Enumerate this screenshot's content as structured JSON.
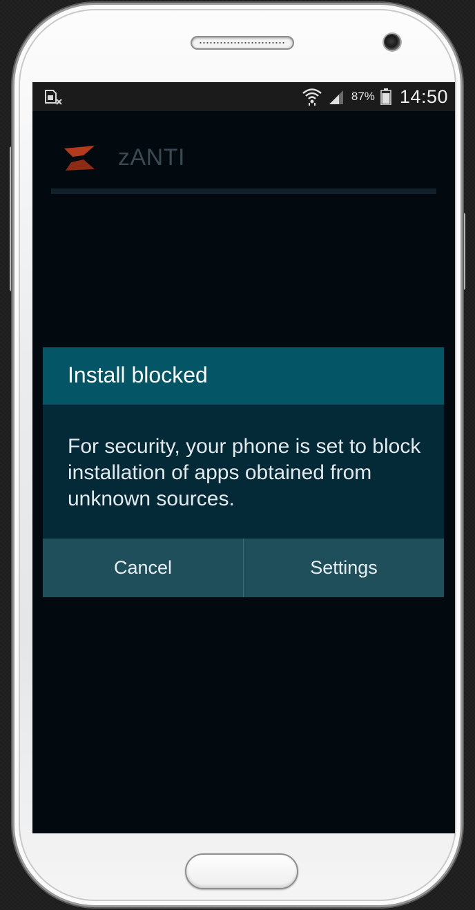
{
  "status_bar": {
    "battery_percent": "87%",
    "battery_level": 0.87,
    "time": "14:50",
    "icons": [
      "sim-card-error-icon",
      "wifi-icon",
      "signal-icon",
      "battery-icon"
    ]
  },
  "app": {
    "title": "zANTI",
    "logo_icon": "zanti-logo-icon",
    "logo_color": "#b33a1c"
  },
  "dialog": {
    "title": "Install blocked",
    "message": "For security, your phone is set to block installation of apps obtained from unknown sources.",
    "cancel_label": "Cancel",
    "settings_label": "Settings"
  },
  "colors": {
    "dialog_title_bg": "#045666",
    "dialog_body_bg": "#032a36",
    "dialog_buttons_bg": "#1e4f5b",
    "screen_bg": "#020a10"
  }
}
